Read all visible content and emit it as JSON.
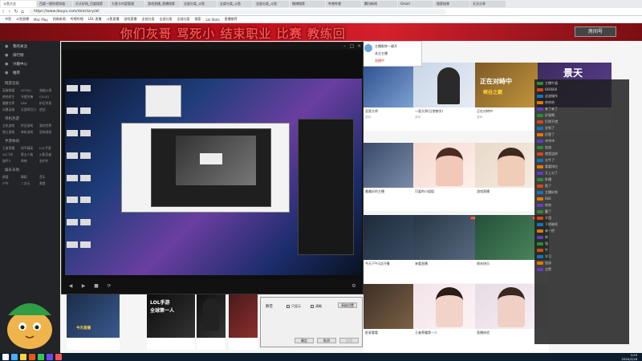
{
  "browser": {
    "tabs": [
      "斗鱼大全",
      "百度一搜你就知道",
      "天天好网_百度搜索",
      "大麦卡内容管理",
      "游戏直播_直播搜索",
      "全部分类_斗鱼",
      "全部分类_斗鱼",
      "全部分类_斗鱼",
      "微博搜索",
      "哔哩哔哩",
      "腾讯新闻",
      "Gmail",
      "搜索结果",
      "天天分享"
    ],
    "url": "https://www.douyu.com/directory/all",
    "bookmarks": [
      "书签",
      "斗鱼直播",
      "Mac Play",
      "网易新闻",
      "哔哩哔哩",
      "LOL 直播",
      "斗鱼直播",
      "游戏直播",
      "全部分类",
      "全部分类",
      "全部分类",
      "搜索",
      "Lol Stats",
      "直播推荐"
    ]
  },
  "site": {
    "banner_text": "你们灰哥 骂死小 结束职业 比赛 教练回",
    "room_button": "房间号"
  },
  "sidebar": {
    "items": [
      "我的关注",
      "排行榜",
      "兴趣中心",
      "推荐"
    ],
    "sections": [
      {
        "title": "网游竞技",
        "entries": [
          "英雄联盟",
          "DOTA2",
          "穿越火线",
          "绝地求生",
          "守望先锋",
          "CS:GO",
          "魔兽世界",
          "DNF",
          "炉石传说",
          "风暴英雄",
          "天涯明月刀",
          "逆战"
        ]
      },
      {
        "title": "单机热游",
        "entries": [
          "主机游戏",
          "怀旧游戏",
          "我的世界",
          "独立游戏",
          "单机游戏",
          "恐怖游戏"
        ]
      },
      {
        "title": "手游休闲",
        "entries": [
          "王者荣耀",
          "和平精英",
          "LOL手游",
          "QQ飞车",
          "第五人格",
          "火影忍者",
          "崩坏3",
          "原神",
          "金铲铲"
        ]
      },
      {
        "title": "娱乐天地",
        "entries": [
          "颜值",
          "舞蹈",
          "音乐",
          "户外",
          "二次元",
          "美食"
        ]
      }
    ]
  },
  "popup": {
    "line1": "主播昵称一键开",
    "line2": "关注主播",
    "line3": "直播中"
  },
  "cards": [
    {
      "title": "亚索大师",
      "meta": "游戏"
    },
    {
      "title": "一直大师(日常教学)",
      "meta": "游戏"
    },
    {
      "title": "正在对峙中",
      "meta": "游戏"
    },
    {
      "title": "最美好的主播",
      "meta": "颜值"
    },
    {
      "title": "可爱的小姐姐",
      "meta": "颜值"
    },
    {
      "title": "游戏直播",
      "meta": "游戏"
    },
    {
      "title": "今天下午3点开播",
      "meta": "游戏"
    },
    {
      "title": "来看直播",
      "meta": "颜值"
    },
    {
      "title": "周末快乐",
      "meta": "颜值"
    },
    {
      "title": "赶紧看看",
      "meta": "颜值"
    },
    {
      "title": "王者荣耀第一人",
      "meta": "游戏"
    },
    {
      "title": "直播体验",
      "meta": "游戏"
    }
  ],
  "card_tags": [
    "iQIESP 10",
    "iQIESP 10",
    "iQIESP 10"
  ],
  "game_banner": "正在对峙中",
  "game_subtitle": "峡谷之巅",
  "game_banner2": "景天",
  "chat": {
    "lines": [
      "主播牛逼",
      "666666",
      "这波操作",
      "哈哈哈",
      "来了来了",
      "好强啊",
      "打得不错",
      "学到了",
      "厉害了",
      "冲冲冲",
      "加油",
      "就是这样",
      "太牛了",
      "看看排位",
      "又上分了",
      "卧槽",
      "稳了",
      "主播好帅",
      "666",
      "哈哈",
      "赢了",
      "开团",
      "下把继续",
      "来一把",
      "帅",
      "强",
      "牛",
      "学习",
      "加油",
      "点赞"
    ],
    "badge_colors": [
      "#2b8a3e",
      "#d9480f",
      "#1971c2",
      "#e67700",
      "#5f3dc4"
    ]
  },
  "player": {
    "title": "",
    "controls": [
      "◀",
      "▶",
      "■",
      "⟳",
      "⚙"
    ]
  },
  "dialog": {
    "label": "静音",
    "check1": "只显示",
    "check2": "清晰",
    "action": "高级设置",
    "ok": "确定",
    "cancel": "取消",
    "apply": "应用"
  },
  "tickers": [
    {
      "text": "LOL手游",
      "color": "#fff"
    },
    {
      "text": "全球第一人",
      "color": "#fff"
    },
    {
      "text": "今天直播",
      "color": "#ffd43b"
    }
  ],
  "taskbar": {
    "time": "3:29",
    "date": "2020/2/16"
  }
}
